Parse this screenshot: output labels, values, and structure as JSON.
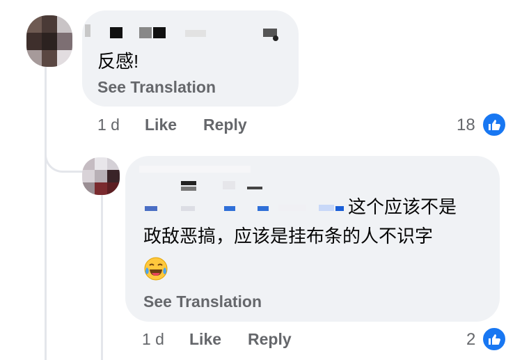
{
  "comments": [
    {
      "text": "反感!",
      "see_translation": "See Translation",
      "time": "1 d",
      "like_label": "Like",
      "reply_label": "Reply",
      "reaction_count": "18"
    },
    {
      "text_line1": "这个应该不是",
      "text_line2": "政敌恶搞，应该是挂布条的人不识字",
      "emoji_icon": "face-with-tears-of-joy-icon",
      "see_translation": "See Translation",
      "time": "1 d",
      "like_label": "Like",
      "reply_label": "Reply",
      "reaction_count": "2"
    }
  ],
  "colors": {
    "bubble": "#f0f2f5",
    "meta_text": "#65676b",
    "like_blue": "#1877f2"
  }
}
